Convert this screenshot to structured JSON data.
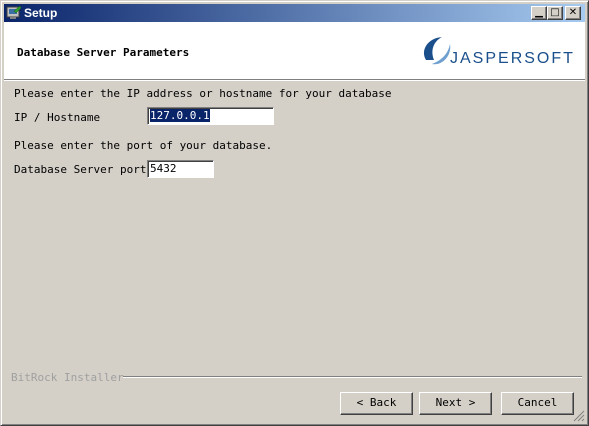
{
  "window": {
    "title": "Setup"
  },
  "header": {
    "page_title": "Database Server Parameters",
    "logo_text": "JASPERSOFT"
  },
  "form": {
    "host_prompt": "Please enter the IP address or hostname for your database",
    "host_label": "IP / Hostname",
    "host_value": "127.0.0.1",
    "port_prompt": "Please enter the port of your database.",
    "port_label": "Database Server port",
    "port_value": "5432"
  },
  "footer": {
    "installer_label": "BitRock Installer",
    "back_label": "< Back",
    "next_label": "Next >",
    "cancel_label": "Cancel"
  },
  "colors": {
    "titlebar_start": "#0a246a",
    "titlebar_end": "#a6caf0",
    "dialog_bg": "#d4d0c8",
    "logo_blue": "#1a4f8b"
  },
  "icons": {
    "app": "installer-icon",
    "minimize": "minimize-icon",
    "maximize": "maximize-icon",
    "close": "close-icon",
    "logo": "jaspersoft-logo"
  }
}
